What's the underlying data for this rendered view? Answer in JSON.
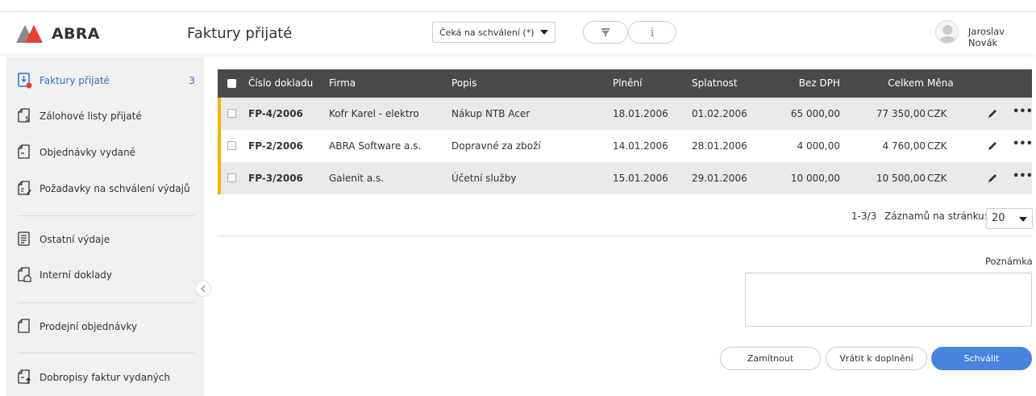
{
  "brand": {
    "name": "ABRA",
    "accent": "#e34234",
    "grey": "#8a8a8a"
  },
  "header": {
    "title": "Faktury přijaté",
    "status_filter": "Čeká na schválení (*)",
    "filter_icon": "filter-icon",
    "info_icon": "info-icon",
    "info_glyph": "i",
    "user_name": "Jaroslav Novák"
  },
  "sidebar": {
    "items": [
      {
        "label": "Faktury přijaté",
        "count": "3",
        "icon": "invoice-received-icon",
        "active": true
      },
      {
        "label": "Zálohové listy přijaté",
        "icon": "advance-invoice-icon"
      },
      {
        "label": "Objednávky vydané",
        "icon": "order-issued-icon"
      },
      {
        "label": "Požadavky na schválení výdajů",
        "icon": "expense-approval-icon"
      },
      {
        "label": "Ostatní výdaje",
        "icon": "other-expenses-icon"
      },
      {
        "label": "Interní doklady",
        "icon": "internal-document-icon"
      },
      {
        "label": "Prodejní objednávky",
        "icon": "sales-order-icon"
      },
      {
        "label": "Dobropisy faktur vydaných",
        "icon": "credit-note-icon"
      }
    ]
  },
  "table": {
    "columns": [
      "Číslo dokladu",
      "Firma",
      "Popis",
      "Plnění",
      "Splatnost",
      "Bez DPH",
      "Celkem",
      "Měna"
    ],
    "rows": [
      {
        "number": "FP-4/2006",
        "company": "Kofr Karel - elektro",
        "description": "Nákup NTB Acer",
        "fulfillment": "18.01.2006",
        "due": "01.02.2006",
        "net": "65 000,00",
        "total": "77 350,00",
        "currency": "CZK"
      },
      {
        "number": "FP-2/2006",
        "company": "ABRA Software a.s.",
        "description": "Dopravné za zboží",
        "fulfillment": "14.01.2006",
        "due": "28.01.2006",
        "net": "4 000,00",
        "total": "4 760,00",
        "currency": "CZK"
      },
      {
        "number": "FP-3/2006",
        "company": "Galenit a.s.",
        "description": "Účetní služby",
        "fulfillment": "15.01.2006",
        "due": "29.01.2006",
        "net": "10 000,00",
        "total": "10 500,00",
        "currency": "CZK"
      }
    ],
    "row_accent": "#f0b400",
    "more_glyph": "•••"
  },
  "pager": {
    "range": "1-3/3",
    "per_page_label": "Záznamů na stránku:",
    "per_page_value": "20"
  },
  "note": {
    "label": "Poznámka",
    "value": ""
  },
  "actions": {
    "reject": "Zamítnout",
    "return": "Vrátit k doplnění",
    "approve": "Schválit"
  }
}
